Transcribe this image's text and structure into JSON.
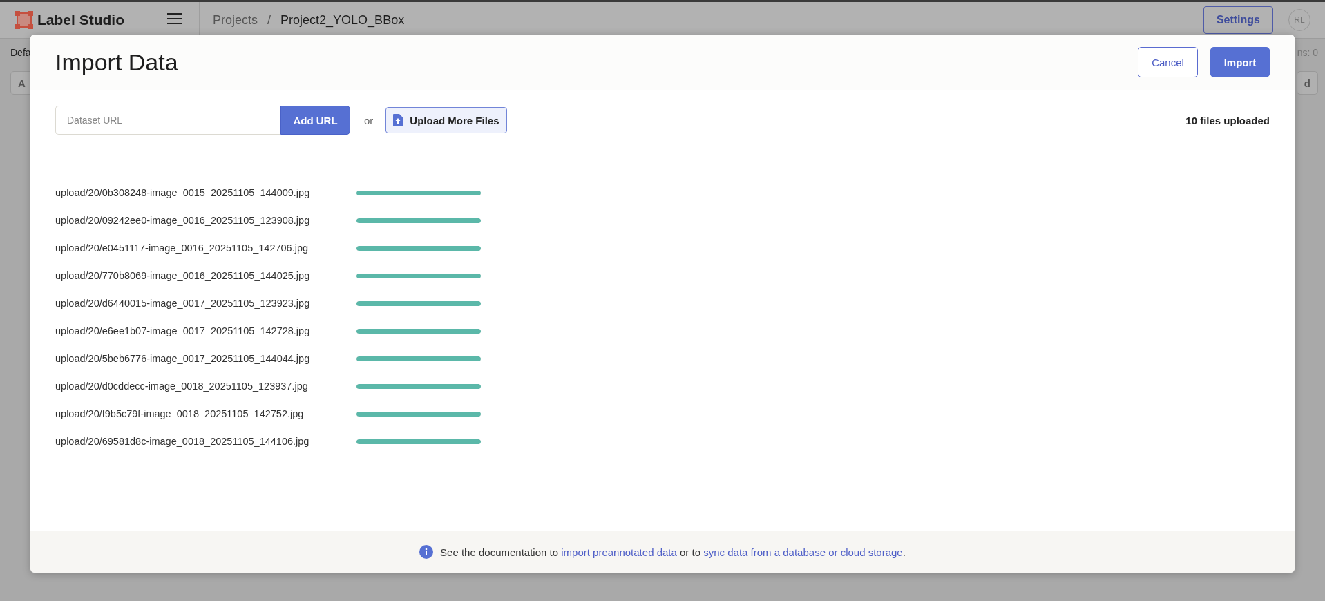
{
  "app": {
    "logo_text": "Label Studio",
    "breadcrumb": [
      {
        "label": "Projects"
      },
      {
        "label": "Project2_YOLO_BBox"
      }
    ],
    "breadcrumb_separator": "/",
    "settings_button": "Settings",
    "avatar": "RL"
  },
  "background": {
    "view_tab": "Defa",
    "left_button": "A",
    "right_text": "ns: 0",
    "right_button": "d"
  },
  "modal": {
    "title": "Import Data",
    "buttons": [
      {
        "label": "Cancel",
        "kind": "secondary"
      },
      {
        "label": "Import",
        "kind": "primary"
      }
    ],
    "url_field": {
      "placeholder": "Dataset URL"
    },
    "add_url_button": "Add URL",
    "or_text": "or",
    "upload_button": "Upload More Files",
    "upload_count": "10 files uploaded",
    "files": [
      {
        "name": "upload/20/0b308248-image_0015_20251105_144009.jpg",
        "level": 1
      },
      {
        "name": "upload/20/09242ee0-image_0016_20251105_123908.jpg",
        "level": 1
      },
      {
        "name": "upload/20/e0451117-image_0016_20251105_142706.jpg",
        "level": 1
      },
      {
        "name": "upload/20/770b8069-image_0016_20251105_144025.jpg",
        "level": 1
      },
      {
        "name": "upload/20/d6440015-image_0017_20251105_123923.jpg",
        "level": 1
      },
      {
        "name": "upload/20/e6ee1b07-image_0017_20251105_142728.jpg",
        "level": 1
      },
      {
        "name": "upload/20/5beb6776-image_0017_20251105_144044.jpg",
        "level": 1
      },
      {
        "name": "upload/20/d0cddecc-image_0018_20251105_123937.jpg",
        "level": 1
      },
      {
        "name": "upload/20/f9b5c79f-image_0018_20251105_142752.jpg",
        "level": 1
      },
      {
        "name": "upload/20/69581d8c-image_0018_20251105_144106.jpg",
        "level": 1
      }
    ],
    "footer": [
      {
        "kind": "text",
        "text": "See the documentation to "
      },
      {
        "kind": "link",
        "text": "import preannotated data"
      },
      {
        "kind": "text",
        "text": " or to "
      },
      {
        "kind": "link",
        "text": "sync data from a database or cloud storage"
      },
      {
        "kind": "text",
        "text": "."
      }
    ]
  }
}
